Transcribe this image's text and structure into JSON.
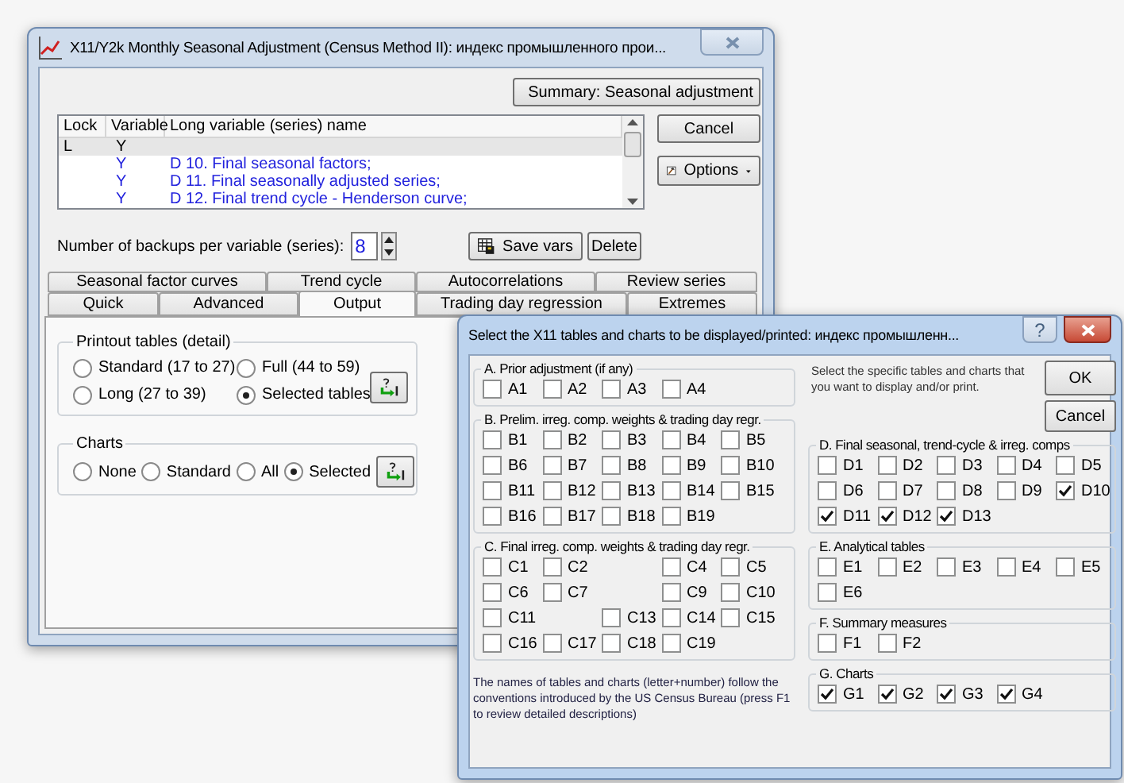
{
  "main_window": {
    "title": "X11/Y2k Monthly Seasonal Adjustment (Census Method II): индекс промышленного прои...",
    "summary_button": "Summary:  Seasonal adjustment",
    "variables_table": {
      "columns": [
        "Lock",
        "Variable",
        "Long variable (series) name"
      ],
      "rows": [
        {
          "lock": "L",
          "variable": "Y",
          "selected": true,
          "kind": "source"
        },
        {
          "variable": "Y",
          "name": "D 10. Final seasonal factors;",
          "selected": false,
          "kind": "output"
        },
        {
          "variable": "Y",
          "name": "D 11. Final seasonally adjusted series;",
          "selected": false,
          "kind": "output"
        },
        {
          "variable": "Y",
          "name": "D 12. Final trend cycle - Henderson curve;",
          "selected": false,
          "kind": "output"
        }
      ]
    },
    "cancel_button": "Cancel",
    "options_button": "Options",
    "backups": {
      "label": "Number of backups per variable (series):",
      "value": "8"
    },
    "save_vars_button": "Save vars",
    "delete_button": "Delete",
    "tab_rows": [
      [
        {
          "label": "Seasonal factor curves",
          "selected": false
        },
        {
          "label": "Trend cycle",
          "selected": false
        },
        {
          "label": "Autocorrelations",
          "selected": false
        },
        {
          "label": "Review series",
          "selected": false
        }
      ],
      [
        {
          "label": "Quick",
          "selected": false
        },
        {
          "label": "Advanced",
          "selected": false
        },
        {
          "label": "Output",
          "selected": true
        },
        {
          "label": "Trading day regression",
          "selected": false
        },
        {
          "label": "Extremes",
          "selected": false
        }
      ]
    ],
    "printout_tables": {
      "title": "Printout tables (detail)",
      "options": [
        {
          "label": "Standard (17 to 27)",
          "selected": false
        },
        {
          "label": "Full (44 to 59)",
          "selected": false
        },
        {
          "label": "Long (27 to 39)",
          "selected": false
        },
        {
          "label": "Selected tables",
          "selected": true
        }
      ]
    },
    "charts": {
      "title": "Charts",
      "options": [
        {
          "label": "None",
          "selected": false
        },
        {
          "label": "Standard",
          "selected": false
        },
        {
          "label": "All",
          "selected": false
        },
        {
          "label": "Selected",
          "selected": true
        }
      ]
    }
  },
  "dialog": {
    "title": "Select the X11 tables and charts to be displayed/printed: индекс промышленн...",
    "help_button": "?",
    "instruction": "Select the specific tables and charts that you want to display and/or print.",
    "ok_button": "OK",
    "cancel_button": "Cancel",
    "left_groups": [
      {
        "title": "A. Prior adjustment (if any)",
        "rows": [
          [
            {
              "label": "A1",
              "checked": false
            },
            {
              "label": "A2",
              "checked": false
            },
            {
              "label": "A3",
              "checked": false
            },
            {
              "label": "A4",
              "checked": false
            }
          ]
        ]
      },
      {
        "title": "B. Prelim. irreg. comp. weights & trading day regr.",
        "rows": [
          [
            {
              "label": "B1",
              "checked": false
            },
            {
              "label": "B2",
              "checked": false
            },
            {
              "label": "B3",
              "checked": false
            },
            {
              "label": "B4",
              "checked": false
            },
            {
              "label": "B5",
              "checked": false
            }
          ],
          [
            {
              "label": "B6",
              "checked": false
            },
            {
              "label": "B7",
              "checked": false
            },
            {
              "label": "B8",
              "checked": false
            },
            {
              "label": "B9",
              "checked": false
            },
            {
              "label": "B10",
              "checked": false
            }
          ],
          [
            {
              "label": "B11",
              "checked": false
            },
            {
              "label": "B12",
              "checked": false
            },
            {
              "label": "B13",
              "checked": false
            },
            {
              "label": "B14",
              "checked": false
            },
            {
              "label": "B15",
              "checked": false
            }
          ],
          [
            {
              "label": "B16",
              "checked": false
            },
            {
              "label": "B17",
              "checked": false
            },
            {
              "label": "B18",
              "checked": false
            },
            {
              "label": "B19",
              "checked": false
            }
          ]
        ]
      },
      {
        "title": "C. Final  irreg. comp. weights & trading day regr.",
        "rows": [
          [
            {
              "label": "C1",
              "checked": false
            },
            {
              "label": "C2",
              "checked": false
            },
            null,
            {
              "label": "C4",
              "checked": false
            },
            {
              "label": "C5",
              "checked": false
            }
          ],
          [
            {
              "label": "C6",
              "checked": false
            },
            {
              "label": "C7",
              "checked": false
            },
            null,
            {
              "label": "C9",
              "checked": false
            },
            {
              "label": "C10",
              "checked": false
            }
          ],
          [
            {
              "label": "C11",
              "checked": false
            },
            null,
            {
              "label": "C13",
              "checked": false
            },
            {
              "label": "C14",
              "checked": false
            },
            {
              "label": "C15",
              "checked": false
            }
          ],
          [
            {
              "label": "C16",
              "checked": false
            },
            {
              "label": "C17",
              "checked": false
            },
            {
              "label": "C18",
              "checked": false
            },
            {
              "label": "C19",
              "checked": false
            }
          ]
        ]
      }
    ],
    "footnote": "The names of tables and charts (letter+number) follow the conventions introduced by the US Census Bureau (press F1 to review detailed descriptions)",
    "right_groups": [
      {
        "title": "D. Final seasonal, trend-cycle & irreg. comps",
        "rows": [
          [
            {
              "label": "D1",
              "checked": false
            },
            {
              "label": "D2",
              "checked": false
            },
            {
              "label": "D3",
              "checked": false
            },
            {
              "label": "D4",
              "checked": false
            },
            {
              "label": "D5",
              "checked": false
            }
          ],
          [
            {
              "label": "D6",
              "checked": false
            },
            {
              "label": "D7",
              "checked": false
            },
            {
              "label": "D8",
              "checked": false
            },
            {
              "label": "D9",
              "checked": false
            },
            {
              "label": "D10",
              "checked": true
            }
          ],
          [
            {
              "label": "D11",
              "checked": true
            },
            {
              "label": "D12",
              "checked": true
            },
            {
              "label": "D13",
              "checked": true
            }
          ]
        ]
      },
      {
        "title": "E. Analytical tables",
        "rows": [
          [
            {
              "label": "E1",
              "checked": false
            },
            {
              "label": "E2",
              "checked": false
            },
            {
              "label": "E3",
              "checked": false
            },
            {
              "label": "E4",
              "checked": false
            },
            {
              "label": "E5",
              "checked": false
            }
          ],
          [
            {
              "label": "E6",
              "checked": false
            }
          ]
        ]
      },
      {
        "title": "F. Summary measures",
        "rows": [
          [
            {
              "label": "F1",
              "checked": false
            },
            {
              "label": "F2",
              "checked": false
            }
          ]
        ]
      },
      {
        "title": "G. Charts",
        "rows": [
          [
            {
              "label": "G1",
              "checked": true
            },
            {
              "label": "G2",
              "checked": true
            },
            {
              "label": "G3",
              "checked": true
            },
            {
              "label": "G4",
              "checked": true
            }
          ]
        ]
      }
    ]
  }
}
